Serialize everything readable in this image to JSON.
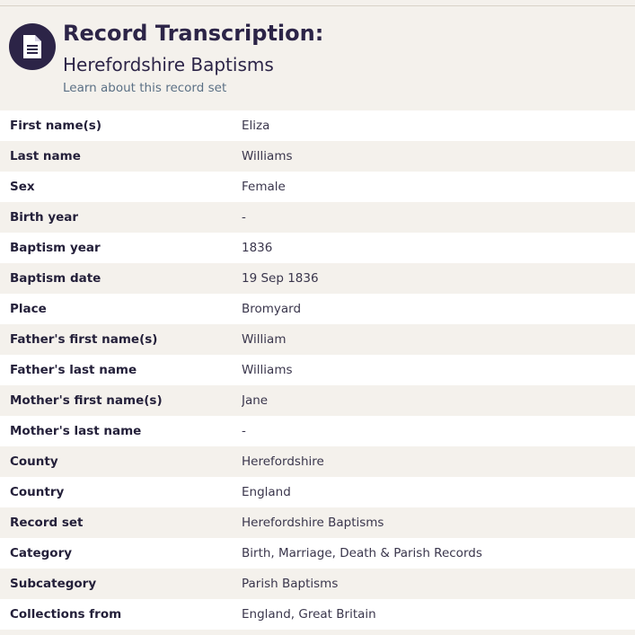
{
  "header": {
    "icon": "document-icon",
    "title": "Record Transcription:",
    "subtitle": "Herefordshire Baptisms",
    "learn_link": "Learn about this record set"
  },
  "colors": {
    "brand": "#2c2447",
    "link": "#5b7085",
    "row_alt": "#f4f1ec",
    "row": "#ffffff"
  },
  "records": [
    {
      "field": "First name(s)",
      "value": "Eliza"
    },
    {
      "field": "Last name",
      "value": "Williams"
    },
    {
      "field": "Sex",
      "value": "Female"
    },
    {
      "field": "Birth year",
      "value": "-"
    },
    {
      "field": "Baptism year",
      "value": "1836"
    },
    {
      "field": "Baptism date",
      "value": "19 Sep 1836"
    },
    {
      "field": "Place",
      "value": "Bromyard"
    },
    {
      "field": "Father's first name(s)",
      "value": "William"
    },
    {
      "field": "Father's last name",
      "value": "Williams"
    },
    {
      "field": "Mother's first name(s)",
      "value": "Jane"
    },
    {
      "field": "Mother's last name",
      "value": "-"
    },
    {
      "field": "County",
      "value": "Herefordshire"
    },
    {
      "field": "Country",
      "value": "England"
    },
    {
      "field": "Record set",
      "value": "Herefordshire Baptisms"
    },
    {
      "field": "Category",
      "value": "Birth, Marriage, Death & Parish Records"
    },
    {
      "field": "Subcategory",
      "value": "Parish Baptisms"
    },
    {
      "field": "Collections from",
      "value": "England, Great Britain"
    }
  ]
}
